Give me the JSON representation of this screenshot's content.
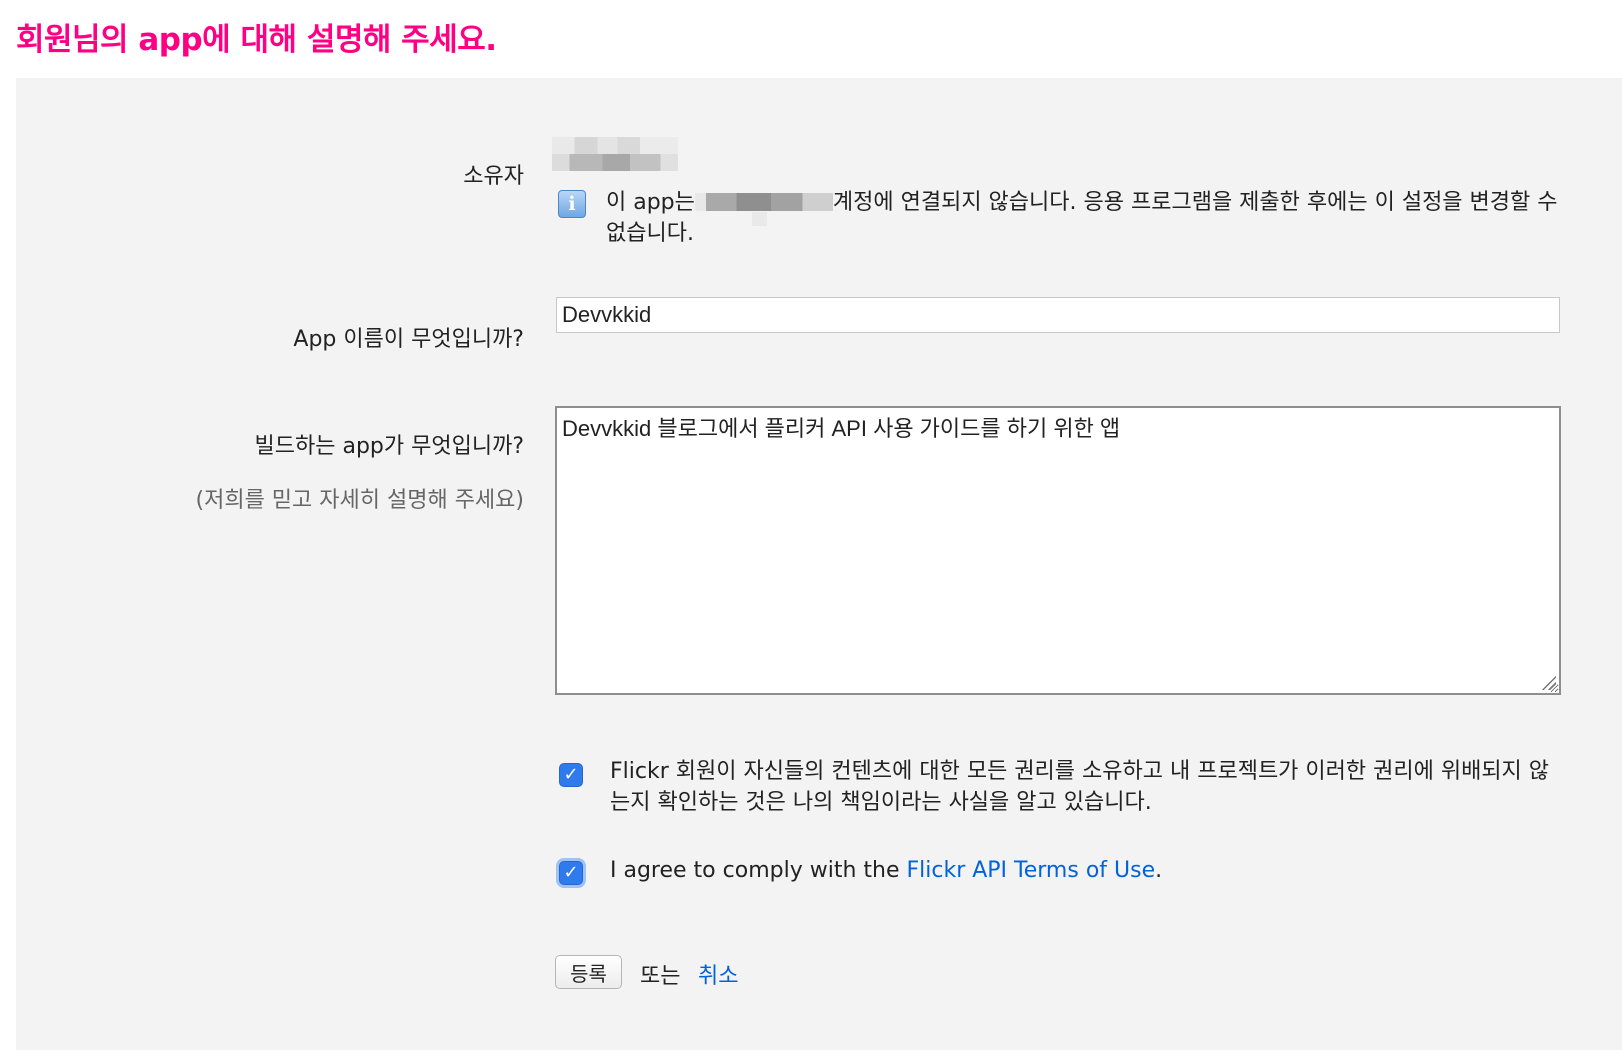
{
  "page": {
    "title": "회원님의 app에 대해 설명해 주세요."
  },
  "owner": {
    "label": "소유자",
    "notice_prefix": "이 app는",
    "notice_suffix": "계정에 연결되지 않습니다. 응용 프로그램을 제출한 후에는 이 설정을 변경할 수 없습니다."
  },
  "app_name": {
    "label": "App 이름이 무엇입니까?",
    "value": "Devvkkid"
  },
  "description": {
    "label": "빌드하는 app가 무엇입니까?",
    "sublabel": "(저희를 믿고 자세히 설명해 주세요)",
    "value": "Devvkkid 블로그에서 플리커 API 사용 가이드를 하기 위한 앱"
  },
  "agreements": {
    "rights_text": "Flickr 회원이 자신들의 컨텐츠에 대한 모든 권리를 소유하고 내 프로젝트가 이러한 권리에 위배되지 않는지 확인하는 것은 나의 책임이라는 사실을 알고 있습니다.",
    "rights_checked": true,
    "terms_prefix": "I agree to comply with the ",
    "terms_link": "Flickr API Terms of Use",
    "terms_suffix": ".",
    "terms_checked": true
  },
  "actions": {
    "submit_label": "등록",
    "or_text": "또는",
    "cancel_label": "취소"
  },
  "colors": {
    "title": "#ff0084",
    "link": "#0063dc",
    "panel_bg": "#f3f3f3",
    "checkbox": "#2f7bee"
  },
  "icons": {
    "info": "info-icon",
    "check": "checkmark-icon"
  }
}
